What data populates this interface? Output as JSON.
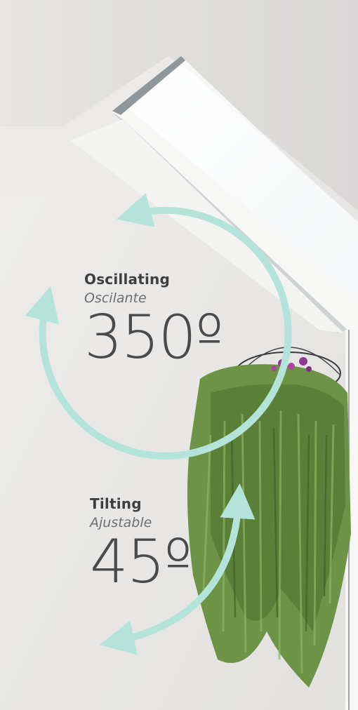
{
  "oscillating": {
    "title": "Oscillating",
    "subtitle": "Oscilante",
    "degrees": "350º"
  },
  "tilting": {
    "title": "Tilting",
    "subtitle": "Ajustable",
    "degrees": "45º"
  },
  "colors": {
    "arrow": "#b4e3da",
    "text": "#3f3f41",
    "wall": "#ecebe9",
    "foliage": "#5f8a3e",
    "flowers": "#8e3a93"
  }
}
